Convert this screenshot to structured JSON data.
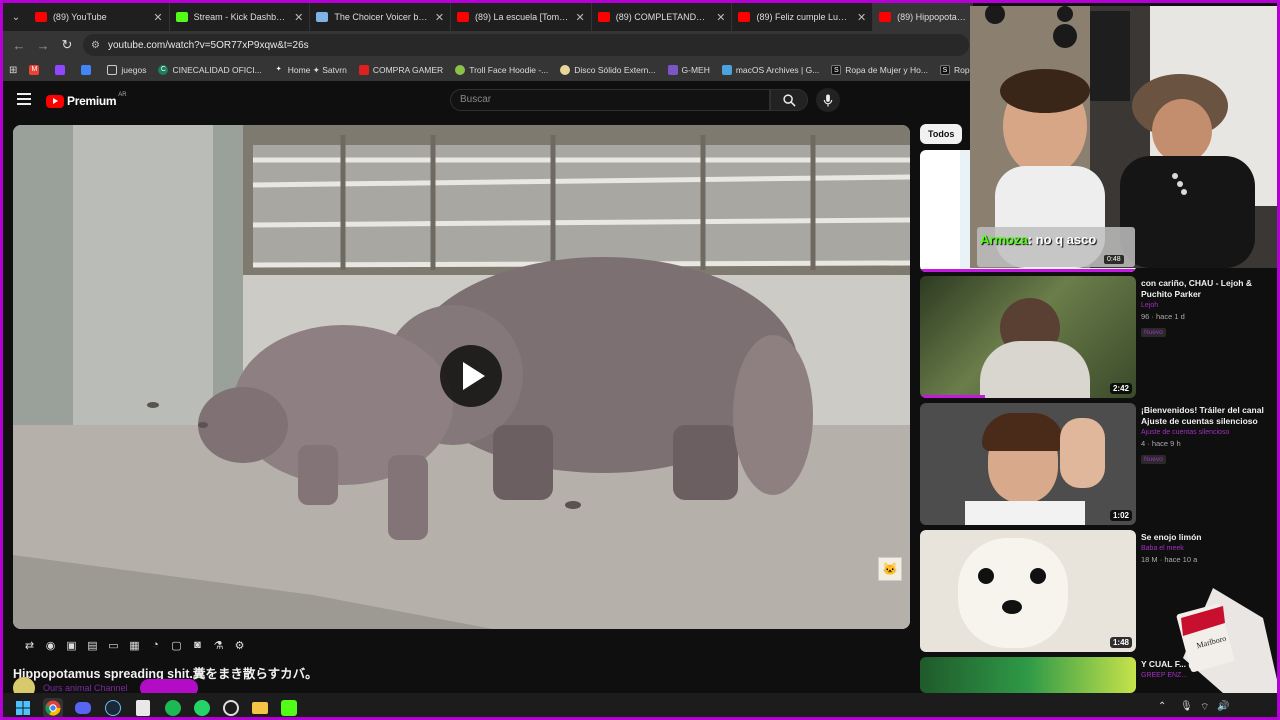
{
  "tabs": [
    {
      "title": "(89) YouTube",
      "favicon_color": "#ff0000"
    },
    {
      "title": "Stream - Kick Dashboard",
      "favicon_color": "#53fc18"
    },
    {
      "title": "The Choicer Voicer by Yea",
      "favicon_color": "#7fb3e6"
    },
    {
      "title": "(89) La escuela [Tomas y T",
      "favicon_color": "#ff0000"
    },
    {
      "title": "(89) COMPLETANDO FIVE",
      "favicon_color": "#ff0000"
    },
    {
      "title": "(89) Feliz cumple Luca Z -",
      "favicon_color": "#ff0000"
    },
    {
      "title": "(89) Hippopotamus s",
      "favicon_color": "#ff0000"
    }
  ],
  "address": {
    "url": "youtube.com/watch?v=5OR77xP9xqw&t=26s"
  },
  "bookmarks": [
    {
      "label": "",
      "icon": "gmail-icon",
      "color": "#ea4335"
    },
    {
      "label": "",
      "icon": "twitch-icon",
      "color": "#9146ff"
    },
    {
      "label": "",
      "icon": "drive-icon",
      "color": "#4285f4"
    },
    {
      "label": "juegos",
      "icon": "folder-icon",
      "color": "#cccccc"
    },
    {
      "label": "CINECALIDAD OFICI...",
      "icon": "cinecalidad-icon",
      "color": "#1a7f5a"
    },
    {
      "label": "Home ✦ Satvrn",
      "icon": "star-icon",
      "color": "#dddddd"
    },
    {
      "label": "COMPRA GAMER",
      "icon": "comprag-icon",
      "color": "#e02020"
    },
    {
      "label": "Troll Face Hoodie -...",
      "icon": "troll-icon",
      "color": "#8bc34a"
    },
    {
      "label": "Disco Sólido Extern...",
      "icon": "disk-icon",
      "color": "#e8d59a"
    },
    {
      "label": "G-MEH",
      "icon": "gmeh-icon",
      "color": "#7a55c7"
    },
    {
      "label": "macOS Archives | G...",
      "icon": "macos-icon",
      "color": "#4aa3df"
    },
    {
      "label": "Ropa de Mujer y Ho...",
      "icon": "shein-icon",
      "color": "#111111"
    },
    {
      "label": "Ropa de Mujer y H",
      "icon": "shein-icon",
      "color": "#111111"
    }
  ],
  "masthead": {
    "logo_text": "Premium",
    "country": "AR",
    "search_placeholder": "Buscar"
  },
  "video": {
    "title": "Hippopotamus spreading shit.糞をまき散らすカバ。",
    "channel": "Ours animal Channel"
  },
  "chip": {
    "label": "Todos"
  },
  "chat_overlay": {
    "user": "Armoza",
    "message": ": no q asco"
  },
  "recommendations": [
    {
      "title": "",
      "channel": "",
      "views": "",
      "duration": "0:48",
      "badge": "",
      "progress": 1.0
    },
    {
      "title": "con cariño, CHAU - Lejoh & Puchito Parker",
      "channel": "Lejoh",
      "views": "96 · hace 1 d",
      "duration": "2:42",
      "badge": "Nuevo",
      "progress": 0.3
    },
    {
      "title": "¡Bienvenidos! Tráiler del canal Ajuste de cuentas silencioso",
      "channel": "Ajuste de cuentas silencioso",
      "views": "4 · hace 9 h",
      "duration": "1:02",
      "badge": "Nuevo",
      "progress": 0
    },
    {
      "title": "Se enojo limón",
      "channel": "Baba el meek",
      "views": "18 M · hace 10 a",
      "duration": "1:48",
      "badge": "",
      "progress": 0
    },
    {
      "title": "Y CUAL F... (Video Ofici...",
      "channel": "GREEP ENZ...",
      "views": "",
      "duration": "",
      "badge": "",
      "progress": 0
    }
  ],
  "colors": {
    "accent": "#c619e0",
    "frame": "#b400d4",
    "kick_green": "#53fc18"
  }
}
